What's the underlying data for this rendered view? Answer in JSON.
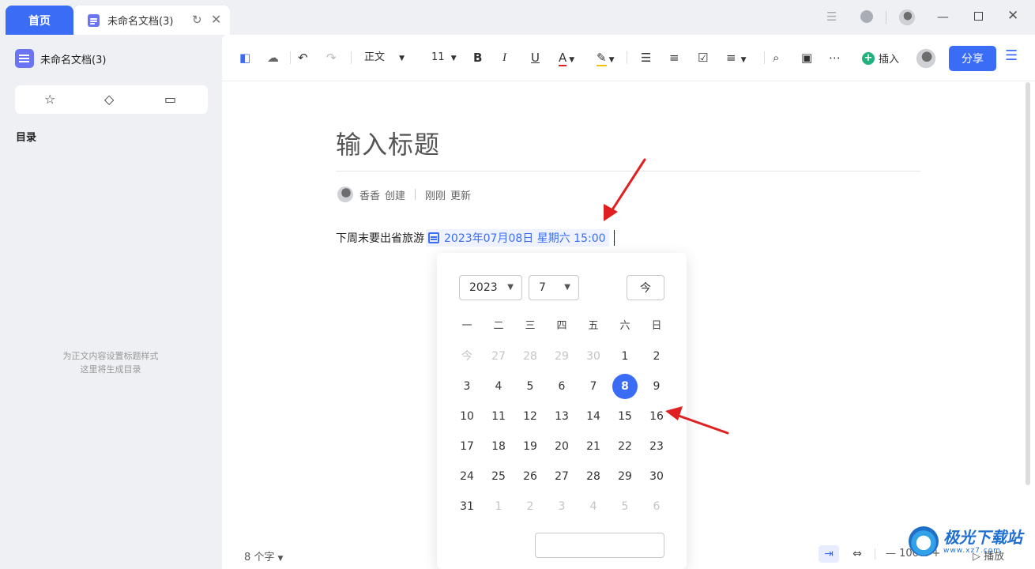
{
  "titlebar": {
    "home_tab": "首页",
    "doc_tab": "未命名文档(3)"
  },
  "sidebar": {
    "doc_title": "未命名文档(3)",
    "toc_label": "目录",
    "toc_hint_1": "为正文内容设置标题样式",
    "toc_hint_2": "这里将生成目录"
  },
  "toolbar": {
    "style_select": "正文",
    "font_size": "11",
    "insert_label": "插入",
    "share_label": "分享"
  },
  "document": {
    "title_placeholder": "输入标题",
    "author": "香香",
    "created_label": "创建",
    "updated_time": "刚刚",
    "updated_label": "更新",
    "body_text": "下周末要出省旅游",
    "date_chip": "2023年07月08日 星期六 15:00"
  },
  "datepicker": {
    "year": "2023",
    "month": "7",
    "today_button": "今",
    "weekdays": [
      "一",
      "二",
      "三",
      "四",
      "五",
      "六",
      "日"
    ],
    "weeks": [
      [
        {
          "d": "今",
          "m": true
        },
        {
          "d": "27",
          "m": true
        },
        {
          "d": "28",
          "m": true
        },
        {
          "d": "29",
          "m": true
        },
        {
          "d": "30",
          "m": true
        },
        {
          "d": "1"
        },
        {
          "d": "2"
        }
      ],
      [
        {
          "d": "3"
        },
        {
          "d": "4"
        },
        {
          "d": "5"
        },
        {
          "d": "6"
        },
        {
          "d": "7"
        },
        {
          "d": "8",
          "s": true
        },
        {
          "d": "9"
        }
      ],
      [
        {
          "d": "10"
        },
        {
          "d": "11"
        },
        {
          "d": "12"
        },
        {
          "d": "13"
        },
        {
          "d": "14"
        },
        {
          "d": "15"
        },
        {
          "d": "16"
        }
      ],
      [
        {
          "d": "17"
        },
        {
          "d": "18"
        },
        {
          "d": "19"
        },
        {
          "d": "20"
        },
        {
          "d": "21"
        },
        {
          "d": "22"
        },
        {
          "d": "23"
        }
      ],
      [
        {
          "d": "24"
        },
        {
          "d": "25"
        },
        {
          "d": "26"
        },
        {
          "d": "27"
        },
        {
          "d": "28"
        },
        {
          "d": "29"
        },
        {
          "d": "30"
        }
      ],
      [
        {
          "d": "31"
        },
        {
          "d": "1",
          "m": true
        },
        {
          "d": "2",
          "m": true
        },
        {
          "d": "3",
          "m": true
        },
        {
          "d": "4",
          "m": true
        },
        {
          "d": "5",
          "m": true
        },
        {
          "d": "6",
          "m": true
        }
      ]
    ]
  },
  "statusbar": {
    "word_count": "8 个字",
    "zoom": "100%",
    "play_label": "播放"
  },
  "watermark": {
    "main": "极光下载站",
    "sub": "www.xz7.com"
  },
  "colors": {
    "accent": "#3b6cf6",
    "arrow": "#e02020"
  }
}
